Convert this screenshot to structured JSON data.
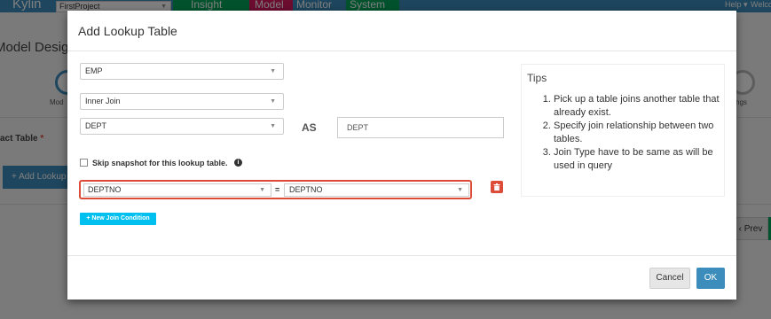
{
  "app": {
    "brand": "Kylin",
    "project": "FirstProject",
    "nav": [
      "Insight",
      "Model",
      "Monitor",
      "System"
    ],
    "help": "Help ▾",
    "welcome": "Welcome"
  },
  "background": {
    "page_title": "Model Designer",
    "step_left": "Mod",
    "step_right": "ngs",
    "fact_table_label": "act Table",
    "required_mark": "*",
    "add_lookup": "+ Add Lookup",
    "prev": "‹ Prev"
  },
  "modal": {
    "title": "Add Lookup Table",
    "fact_table": "EMP",
    "join_type": "Inner Join",
    "lookup_table": "DEPT",
    "as_label": "AS",
    "alias": "DEPT",
    "skip_snapshot_label": "Skip snapshot for this lookup table.",
    "join_condition": {
      "left_column": "DEPTNO",
      "operator": "=",
      "right_column": "DEPTNO"
    },
    "new_join_condition": "+ New Join Condition",
    "tips": {
      "title": "Tips",
      "items": [
        "Pick up a table joins another table that already exist.",
        "Specify join relationship between two tables.",
        "Join Type have to be same as will be used in query"
      ]
    },
    "cancel": "Cancel",
    "ok": "OK"
  }
}
